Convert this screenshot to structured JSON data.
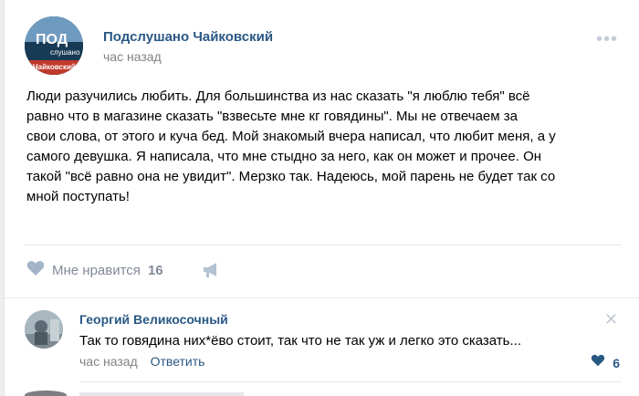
{
  "post": {
    "author": "Подслушано Чайковский",
    "time": "час назад",
    "avatar_icon": "community-logo",
    "logo_text_top": "ПОД",
    "logo_text_mid": "слушано",
    "logo_text_bottom": "Чайковский",
    "lines": [
      "Люди разучились любить. Для большинства из нас сказать \"я люблю тебя\" всё",
      "равно что в магазине сказать \"взвесьте мне кг говядины\". Мы не отвечаем за",
      "свои слова, от этого и куча бед. Мой знакомый вчера написал, что любит меня, а у",
      "самого девушка. Я написала, что мне стыдно за него, как он может и прочее. Он",
      "такой \"всё равно она не увидит\". Мерзко так. Надеюсь, мой парень не будет так со",
      "мной поступать!"
    ]
  },
  "actions": {
    "like_label": "Мне нравится",
    "like_count": "16",
    "like_icon": "heart-icon",
    "share_icon": "megaphone-icon"
  },
  "comment": {
    "author": "Георгий Великосочный",
    "text": "Так то говядина них*ёво стоит, так что не так уж и легко это сказать...",
    "time": "час назад",
    "reply_label": "Ответить",
    "like_count": "6",
    "close_icon": "close-icon",
    "like_icon": "heart-icon"
  },
  "colors": {
    "link": "#2a5885",
    "muted": "#828282",
    "icon": "#b3c2d3"
  }
}
